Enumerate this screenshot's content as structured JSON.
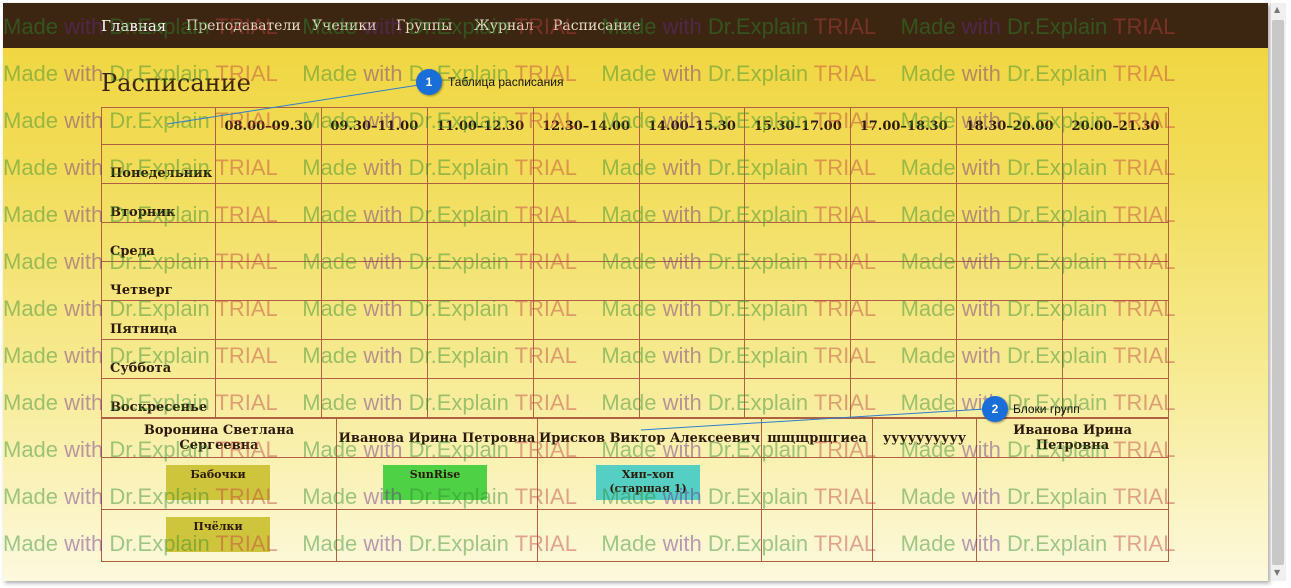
{
  "nav": {
    "items": [
      "Главная",
      "Преподаватели",
      "Ученики",
      "Группы",
      "Журнал",
      "Расписание"
    ]
  },
  "page": {
    "title": "Расписание"
  },
  "schedule": {
    "time_slots": [
      "08.00–09.30",
      "09.30–11.00",
      "11.00–12.30",
      "12.30–14.00",
      "14.00–15.30",
      "15.30–17.00",
      "17.00–18.30",
      "18.30–20.00",
      "20.00–21.30"
    ],
    "days": [
      "Понедельник",
      "Вторник",
      "Среда",
      "Четверг",
      "Пятница",
      "Суббота",
      "Воскресенье"
    ]
  },
  "groups": {
    "teachers": [
      "Воронина Светлана Сергеевна",
      "Иванова Ирина Петровна",
      "Ирисков Виктор Алексеевич",
      "шщщрщгиеа",
      "уууууууууу",
      "Иванова Ирина Петровна"
    ],
    "blocks": [
      {
        "label": "Бабочки",
        "color": "#cfc53c"
      },
      {
        "label": "SunRise",
        "color": "#4fd145"
      },
      {
        "label": "Хип–хоп\n(старшая 1)",
        "color": "#55cfc4"
      },
      {
        "label": "Пчёлки",
        "color": "#cfc53c"
      }
    ]
  },
  "callouts": [
    {
      "number": "1",
      "label": "Таблица расписания"
    },
    {
      "number": "2",
      "label": "Блоки групп"
    }
  ],
  "watermark": {
    "made": "Made",
    "with": "with",
    "brand": "Dr.Explain",
    "trial": "TRIAL"
  },
  "colors": {
    "navbar": "#3c2612",
    "border": "#b06040",
    "callout": "#1a6ed8"
  }
}
